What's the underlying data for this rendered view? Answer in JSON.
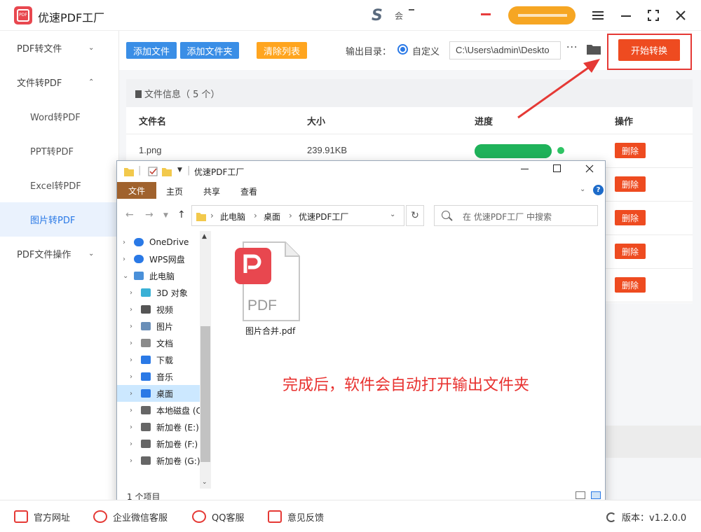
{
  "app": {
    "title": "优速PDF工厂",
    "logo_text": "PDF",
    "center_mark": "S",
    "center_text": "会"
  },
  "window_controls": {
    "menu_icon": "hamburger-icon",
    "minimize_icon": "minimize-icon",
    "maximize_icon": "maximize-icon",
    "close_icon": "close-icon"
  },
  "sidebar": {
    "items": [
      {
        "label": "PDF转文件",
        "type": "group",
        "chevron": "down"
      },
      {
        "label": "文件转PDF",
        "type": "group",
        "chevron": "up"
      },
      {
        "label": "Word转PDF",
        "type": "sub"
      },
      {
        "label": "PPT转PDF",
        "type": "sub"
      },
      {
        "label": "Excel转PDF",
        "type": "sub"
      },
      {
        "label": "图片转PDF",
        "type": "sub",
        "active": true
      },
      {
        "label": "PDF文件操作",
        "type": "group",
        "chevron": "down"
      }
    ]
  },
  "toolbar": {
    "add_file": "添加文件",
    "add_folder": "添加文件夹",
    "clear_list": "清除列表",
    "output_label": "输出目录：",
    "radio_custom": "自定义",
    "output_path": "C:\\Users\\admin\\Deskto",
    "more": "···",
    "start": "开始转换"
  },
  "file_panel": {
    "info_title": "文件信息（ 5 个）",
    "columns": [
      "文件名",
      "大小",
      "进度",
      "操作"
    ],
    "rows": [
      {
        "name": "1.png",
        "size": "239.91KB",
        "progress": 1.0,
        "action": "删除"
      },
      {
        "name": "",
        "size": "",
        "action": "删除"
      },
      {
        "name": "",
        "size": "",
        "action": "删除"
      },
      {
        "name": "",
        "size": "",
        "action": "删除"
      },
      {
        "name": "",
        "size": "",
        "action": "删除"
      }
    ]
  },
  "explorer": {
    "title": "优速PDF工厂",
    "ribbon_tabs": [
      "文件",
      "主页",
      "共享",
      "查看"
    ],
    "address": [
      "此电脑",
      "桌面",
      "优速PDF工厂"
    ],
    "search_placeholder": "在 优速PDF工厂 中搜索",
    "tree": [
      {
        "label": "OneDrive",
        "icon": "cloud-icon",
        "level": 0
      },
      {
        "label": "WPS网盘",
        "icon": "cloud-icon",
        "level": 0
      },
      {
        "label": "此电脑",
        "icon": "computer-icon",
        "level": 0,
        "expanded": true
      },
      {
        "label": "3D 对象",
        "icon": "cube-icon",
        "level": 1
      },
      {
        "label": "视频",
        "icon": "video-icon",
        "level": 1
      },
      {
        "label": "图片",
        "icon": "picture-icon",
        "level": 1
      },
      {
        "label": "文档",
        "icon": "document-icon",
        "level": 1
      },
      {
        "label": "下载",
        "icon": "download-icon",
        "level": 1
      },
      {
        "label": "音乐",
        "icon": "music-icon",
        "level": 1
      },
      {
        "label": "桌面",
        "icon": "desktop-icon",
        "level": 1,
        "selected": true
      },
      {
        "label": "本地磁盘 (C",
        "icon": "drive-icon",
        "level": 1
      },
      {
        "label": "新加卷 (E:)",
        "icon": "drive-icon",
        "level": 1
      },
      {
        "label": "新加卷 (F:)",
        "icon": "drive-icon",
        "level": 1
      },
      {
        "label": "新加卷 (G:)",
        "icon": "drive-icon",
        "level": 1
      }
    ],
    "file": {
      "name": "图片合并.pdf",
      "badge": "PDF"
    },
    "note": "完成后，软件会自动打开输出文件夹",
    "status": "1 个项目"
  },
  "footer": {
    "links": [
      "官方网址",
      "企业微信客服",
      "QQ客服",
      "意见反馈"
    ],
    "version": "版本：v1.2.0.0"
  },
  "colors": {
    "accent_blue": "#3a8ee6",
    "orange": "#ffa51f",
    "start_red": "#ee4b20",
    "progress_green": "#2fc464",
    "note_red": "#e8312f"
  }
}
